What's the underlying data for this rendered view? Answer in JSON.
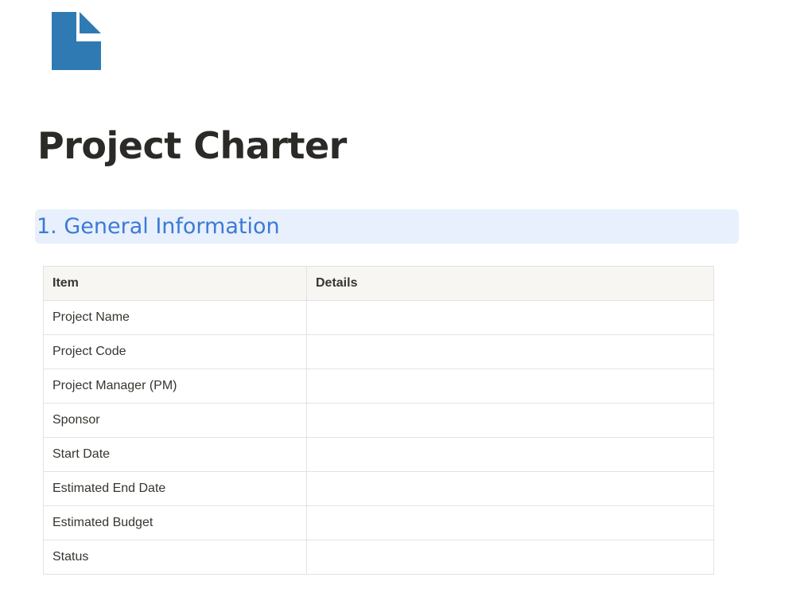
{
  "page": {
    "icon": "document-icon",
    "title": "Project Charter"
  },
  "section": {
    "heading": "1. General Information"
  },
  "table": {
    "headers": [
      "Item",
      "Details"
    ],
    "rows": [
      {
        "item": "Project Name",
        "details": ""
      },
      {
        "item": "Project Code",
        "details": ""
      },
      {
        "item": "Project Manager (PM)",
        "details": ""
      },
      {
        "item": "Sponsor",
        "details": ""
      },
      {
        "item": "Start Date",
        "details": ""
      },
      {
        "item": "Estimated End Date",
        "details": ""
      },
      {
        "item": "Estimated Budget",
        "details": ""
      },
      {
        "item": "Status",
        "details": ""
      }
    ]
  },
  "colors": {
    "icon": "#2f7ab3",
    "heading_text": "#3d7ad3",
    "heading_bg": "#e7f0fc",
    "header_bg": "#f7f6f3",
    "border": "#e3e2e0"
  }
}
